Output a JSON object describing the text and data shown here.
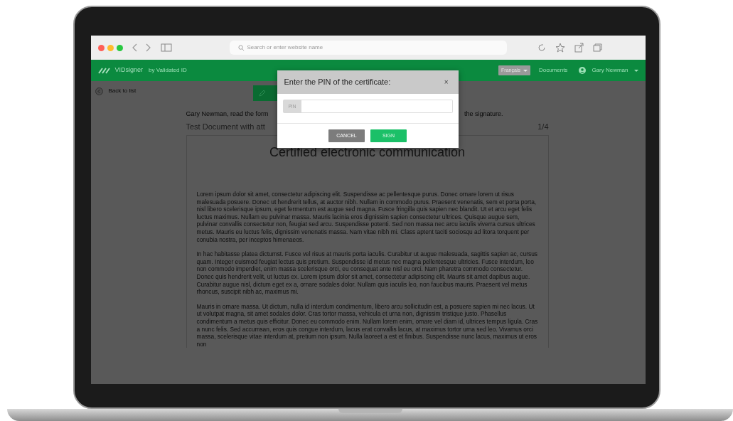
{
  "browser": {
    "address_placeholder": "Search or enter website name"
  },
  "navbar": {
    "brand": "VIDsigner",
    "tagline": "by Validated ID",
    "language": "Français",
    "links": [
      "Documents"
    ],
    "user": "Gary Newman"
  },
  "back_link": "Back to list",
  "instruction": {
    "start": "Gary Newman, read the  form",
    "end": "the signature."
  },
  "document": {
    "name": "Test Document with att",
    "page": "1/4",
    "title": "Certified electronic communication",
    "paragraphs": [
      "Lorem ipsum dolor sit amet, consectetur adipiscing elit. Suspendisse ac pellentesque purus. Donec ornare lorem ut risus malesuada posuere. Donec ut hendrerit tellus, at auctor nibh. Nullam in commodo purus. Praesent venenatis, sem et porta porta, nisl libero scelerisque ipsum, eget fermentum est augue sed magna. Fusce fringilla quis sapien nec blandit. Ut et arcu eget felis luctus maximus. Nullam eu pulvinar massa. Mauris lacinia eros dignissim sapien consectetur ultrices. Quisque augue sem, pulvinar convallis consectetur non, feugiat sed arcu. Suspendisse potenti. Sed non massa nec arcu iaculis viverra cursus ultrices metus. Mauris eu luctus felis, dignissim venenatis massa. Nam vitae nibh mi. Class aptent taciti sociosqu ad litora torquent per conubia nostra, per inceptos himenaeos.",
      "In hac habitasse platea dictumst. Fusce vel risus at mauris porta iaculis. Curabitur ut augue malesuada, sagittis sapien ac, cursus quam. Integer euismod feugiat lectus quis pretium. Suspendisse id metus nec magna pellentesque ultricies. Fusce interdum, leo non commodo imperdiet, enim massa scelerisque orci, eu consequat ante nisl eu orci. Nam pharetra commodo consectetur. Donec quis hendrerit velit, ut luctus ex. Lorem ipsum dolor sit amet, consectetur adipiscing elit. Mauris sit amet dapibus augue. Curabitur augue nisl, dictum eget ex a, ornare sodales dolor. Nullam quis iaculis leo, non faucibus mauris. Praesent vel metus rhoncus, suscipit nibh ac, maximus mi.",
      "Mauris in ornare massa. Ut dictum, nulla id interdum condimentum, libero arcu sollicitudin est, a posuere sapien mi nec lacus. Ut ut volutpat magna, sit amet sodales dolor. Cras tortor massa, vehicula et urna non, dignissim tristique justo. Phasellus condimentum a metus quis efficitur. Donec eu commodo enim. Nullam lorem enim, ornare vel diam id, ultrices tempus ligula. Cras a nunc felis. Sed accumsan, eros quis congue interdum, lacus erat convallis lacus, at maximus tortor urna sed leo. Vivamus orci massa, scelerisque vitae interdum at, pretium non ipsum. Nulla laoreet a est et finibus. Suspendisse nunc lacus, maximus ut eros non"
    ]
  },
  "modal": {
    "title": "Enter the PIN of the certificate:",
    "close": "×",
    "pin_label": "PIN",
    "buttons": [
      {
        "label": "CANCEL",
        "kind": "secondary"
      },
      {
        "label": "SIGN",
        "kind": "primary"
      }
    ]
  }
}
